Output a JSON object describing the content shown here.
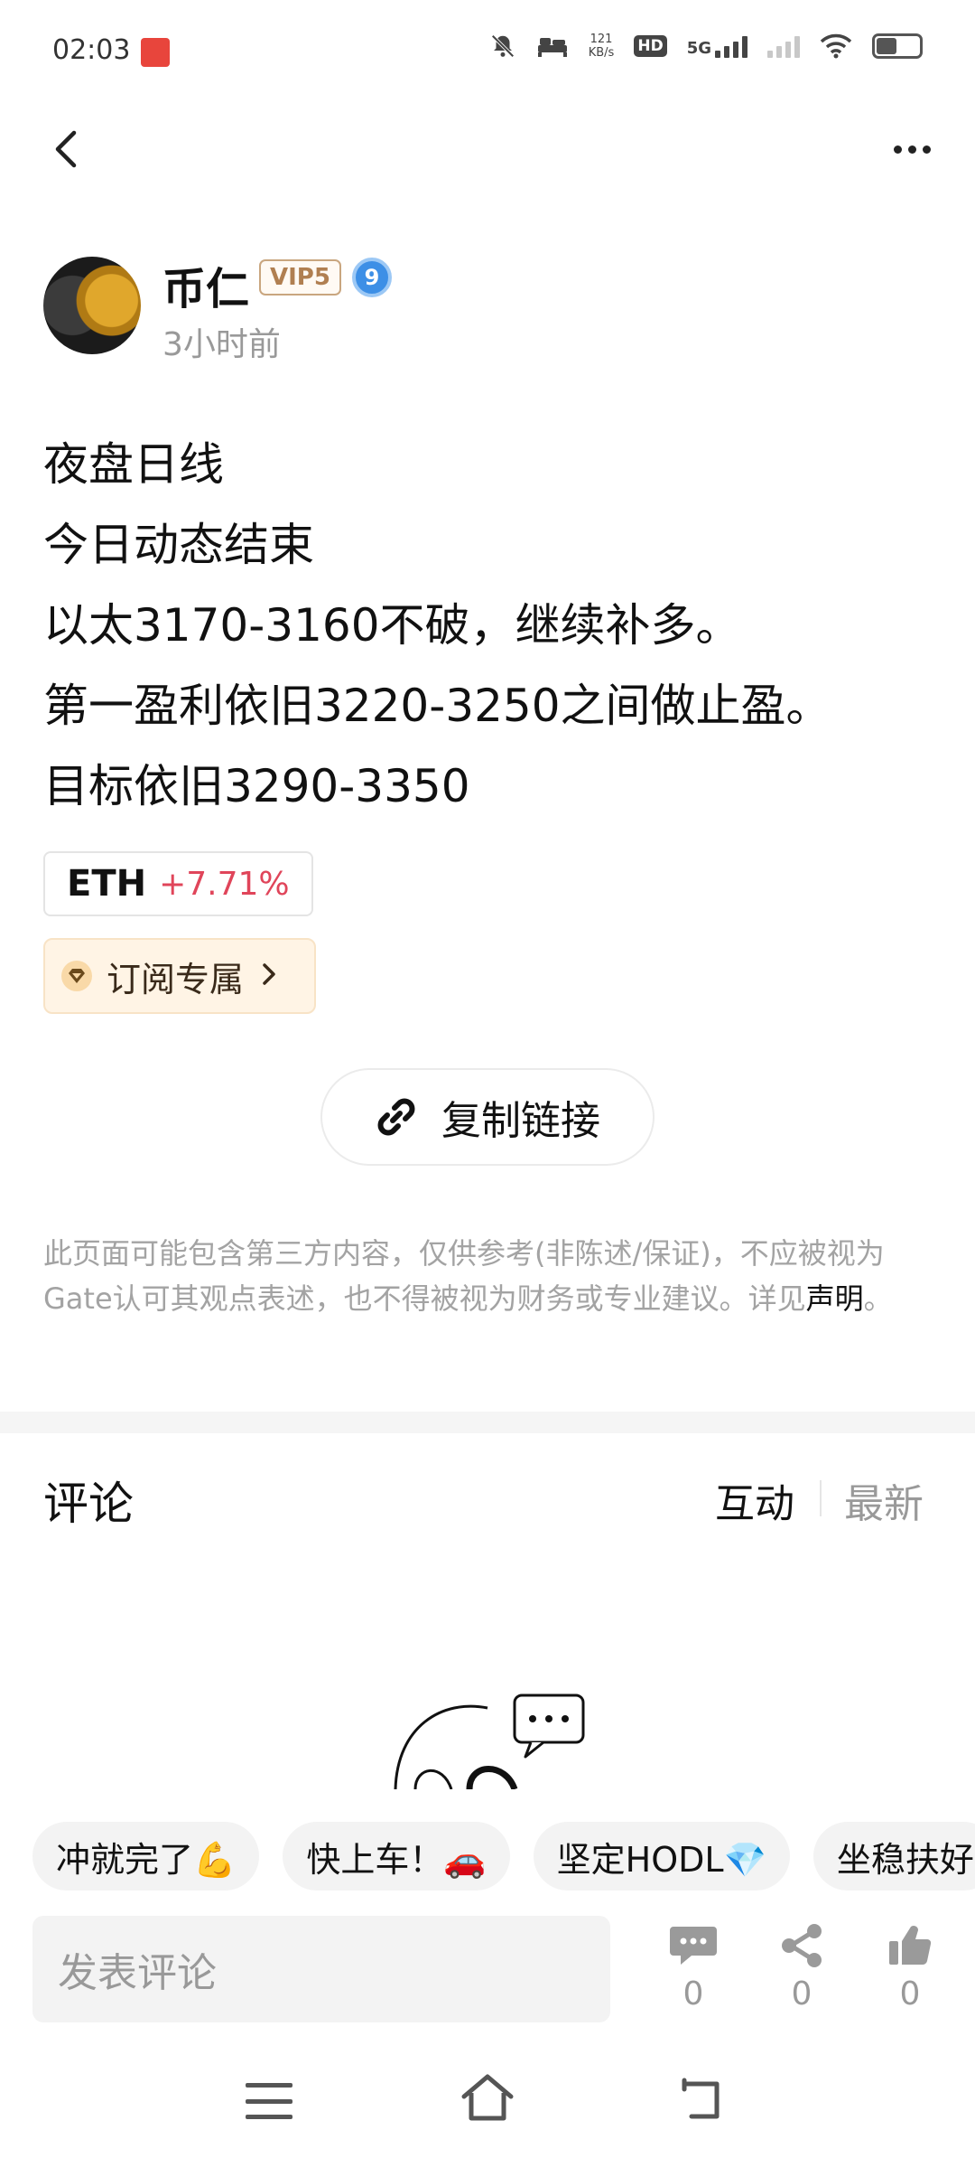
{
  "status_bar": {
    "time": "02:03",
    "net_speed_value": "121",
    "net_speed_unit": "KB/s",
    "hd_label": "HD",
    "network_label": "5G"
  },
  "header": {
    "back_icon": "chevron-left-icon",
    "more_icon": "more-horizontal-icon"
  },
  "author": {
    "name": "币仁",
    "vip": "VIP5",
    "level": "9",
    "time_ago": "3小时前"
  },
  "post": {
    "lines": [
      "夜盘日线",
      "今日动态结束",
      "以太3170-3160不破，继续补多。",
      "第一盈利依旧3220-3250之间做止盈。",
      "目标依旧3290-3350"
    ],
    "ticker": {
      "symbol": "ETH",
      "change": "+7.71%"
    },
    "subscribe_label": "订阅专属",
    "copy_link_label": "复制链接"
  },
  "disclaimer": {
    "text": "此页面可能包含第三方内容，仅供参考(非陈述/保证)，不应被视为Gate认可其观点表述，也不得被视为财务或专业建议。详见",
    "link": "声明",
    "end": "。"
  },
  "comments": {
    "title": "评论",
    "tab_interact": "互动",
    "tab_latest": "最新",
    "chips": [
      "冲就完了💪",
      "快上车！🚗",
      "坚定HODL💎",
      "坐稳扶好"
    ]
  },
  "bottom_bar": {
    "input_placeholder": "发表评论",
    "comment_count": "0",
    "share_count": "0",
    "like_count": "0"
  },
  "colors": {
    "positive_change": "#e0455a",
    "vip_gold": "#b07f51",
    "level_blue": "#3d8fe6"
  }
}
